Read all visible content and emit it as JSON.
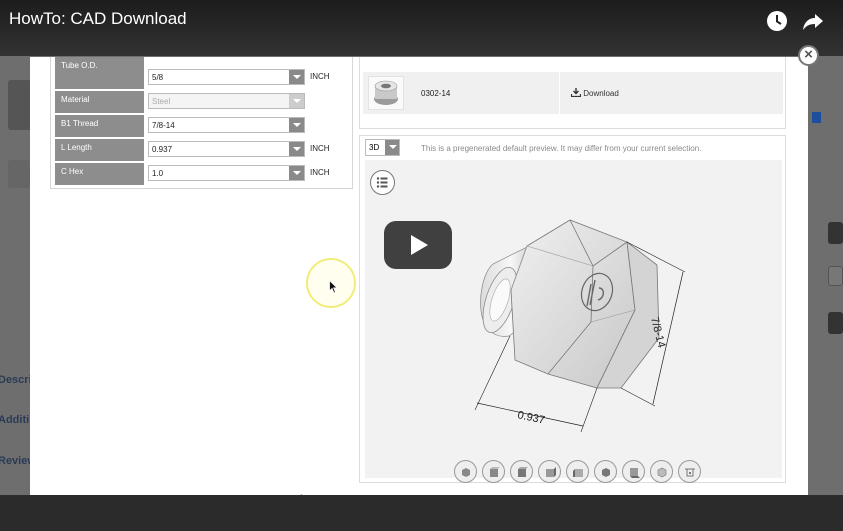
{
  "video": {
    "title": "HowTo: CAD Download",
    "play_label": "Play",
    "bottom_caption": "•"
  },
  "background_page": {
    "side_labels": [
      "Descri",
      "Additi",
      "Review"
    ]
  },
  "params": [
    {
      "label": "Tube O.D.",
      "value": "5/8",
      "unit": "INCH",
      "disabled": false
    },
    {
      "label": "Material",
      "value": "Steel",
      "unit": "",
      "disabled": true
    },
    {
      "label": "B1 Thread",
      "value": "7/8-14",
      "unit": "",
      "disabled": false
    },
    {
      "label": "L Length",
      "value": "0.937",
      "unit": "INCH",
      "disabled": false
    },
    {
      "label": "C Hex",
      "value": "1.0",
      "unit": "INCH",
      "disabled": false
    }
  ],
  "download": {
    "part_number": "0302-14",
    "button_label": "Download"
  },
  "preview": {
    "view_mode": "3D",
    "note": "This is a pregenerated default preview. It may differ from your current selection.",
    "dimension_length": "0.937",
    "dimension_thread": "7/8-14",
    "view_buttons": [
      "view-iso",
      "view-front",
      "view-top",
      "view-right",
      "view-left",
      "view-back",
      "view-bottom",
      "view-box",
      "view-home"
    ]
  },
  "colors": {
    "label_bg": "#8d8d8d",
    "dark_bar": "#1b1b1b",
    "cursor_ring": "#f2ec7a"
  }
}
